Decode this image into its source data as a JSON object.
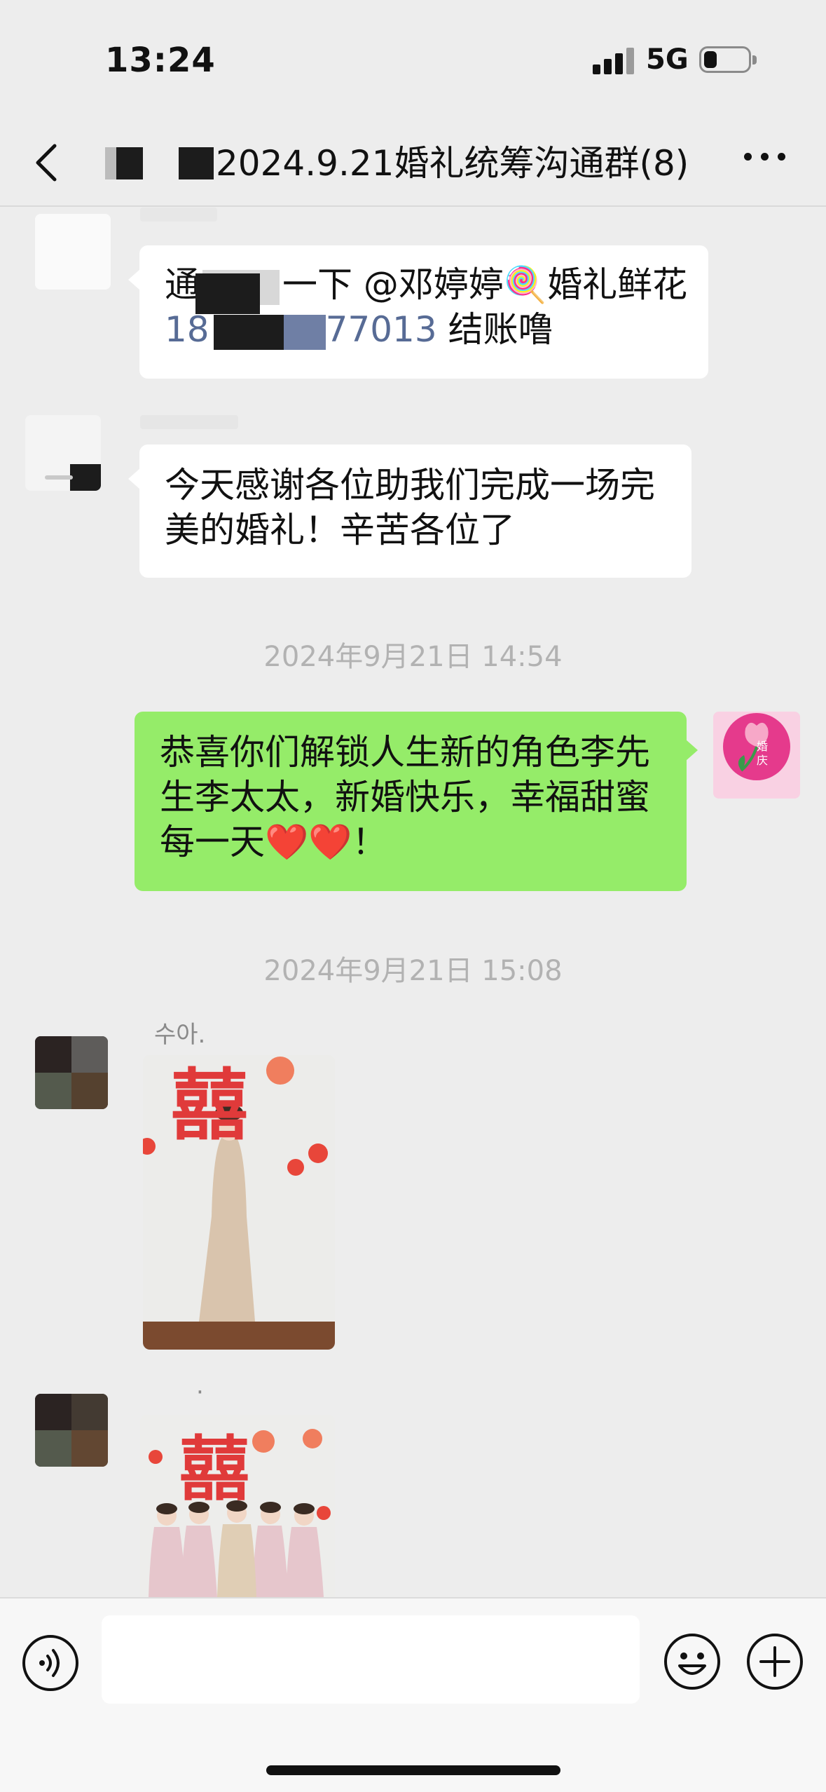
{
  "status_bar": {
    "time": "13:24",
    "network": "5G",
    "battery_level": 0.3
  },
  "nav": {
    "title": "2024.9.21婚礼统筹沟通群(8)",
    "back_icon": "chevron-left-icon",
    "more_icon": "ellipsis-icon"
  },
  "messages": [
    {
      "side": "left",
      "text_prefix": "通",
      "text_mid": "一下 @邓婷婷🍭婚礼鲜花",
      "phone_prefix": "18",
      "phone_suffix": "77013",
      "text_suffix": " 结账噜"
    },
    {
      "side": "left",
      "text": "今天感谢各位助我们完成一场完美的婚礼！辛苦各位了"
    },
    {
      "type": "timestamp",
      "text": "2024年9月21日 14:54"
    },
    {
      "side": "right",
      "text": "恭喜你们解锁人生新的角色李先生李太太，新婚快乐，幸福甜蜜每一天❤️❤️！",
      "avatar_label": "婚庆"
    },
    {
      "type": "timestamp",
      "text": "2024年9月21日 15:08"
    },
    {
      "side": "left",
      "sender": "수아.",
      "type": "image",
      "glyph": "囍"
    },
    {
      "side": "left",
      "sender": "·",
      "type": "image",
      "glyph": "囍"
    }
  ],
  "input_bar": {
    "voice_icon": "voice-icon",
    "emoji_icon": "emoji-icon",
    "plus_icon": "plus-icon",
    "value": ""
  },
  "colors": {
    "background": "#ededed",
    "sent_bubble": "#95ec69",
    "received_bubble": "#ffffff",
    "link": "#576b95"
  }
}
